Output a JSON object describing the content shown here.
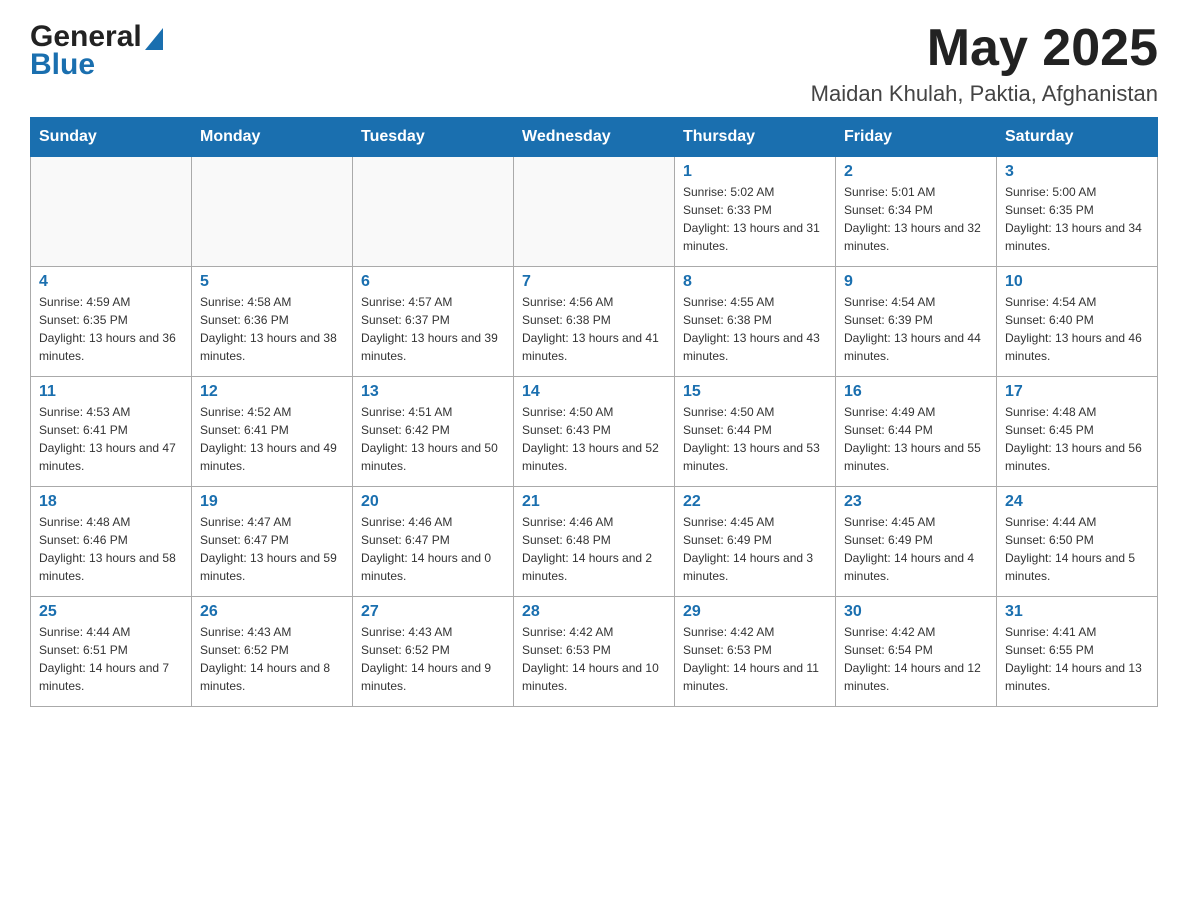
{
  "header": {
    "logo": {
      "general_text": "General",
      "blue_text": "Blue"
    },
    "month_title": "May 2025",
    "location": "Maidan Khulah, Paktia, Afghanistan"
  },
  "days_of_week": [
    "Sunday",
    "Monday",
    "Tuesday",
    "Wednesday",
    "Thursday",
    "Friday",
    "Saturday"
  ],
  "weeks": [
    [
      {
        "day": "",
        "info": ""
      },
      {
        "day": "",
        "info": ""
      },
      {
        "day": "",
        "info": ""
      },
      {
        "day": "",
        "info": ""
      },
      {
        "day": "1",
        "info": "Sunrise: 5:02 AM\nSunset: 6:33 PM\nDaylight: 13 hours and 31 minutes."
      },
      {
        "day": "2",
        "info": "Sunrise: 5:01 AM\nSunset: 6:34 PM\nDaylight: 13 hours and 32 minutes."
      },
      {
        "day": "3",
        "info": "Sunrise: 5:00 AM\nSunset: 6:35 PM\nDaylight: 13 hours and 34 minutes."
      }
    ],
    [
      {
        "day": "4",
        "info": "Sunrise: 4:59 AM\nSunset: 6:35 PM\nDaylight: 13 hours and 36 minutes."
      },
      {
        "day": "5",
        "info": "Sunrise: 4:58 AM\nSunset: 6:36 PM\nDaylight: 13 hours and 38 minutes."
      },
      {
        "day": "6",
        "info": "Sunrise: 4:57 AM\nSunset: 6:37 PM\nDaylight: 13 hours and 39 minutes."
      },
      {
        "day": "7",
        "info": "Sunrise: 4:56 AM\nSunset: 6:38 PM\nDaylight: 13 hours and 41 minutes."
      },
      {
        "day": "8",
        "info": "Sunrise: 4:55 AM\nSunset: 6:38 PM\nDaylight: 13 hours and 43 minutes."
      },
      {
        "day": "9",
        "info": "Sunrise: 4:54 AM\nSunset: 6:39 PM\nDaylight: 13 hours and 44 minutes."
      },
      {
        "day": "10",
        "info": "Sunrise: 4:54 AM\nSunset: 6:40 PM\nDaylight: 13 hours and 46 minutes."
      }
    ],
    [
      {
        "day": "11",
        "info": "Sunrise: 4:53 AM\nSunset: 6:41 PM\nDaylight: 13 hours and 47 minutes."
      },
      {
        "day": "12",
        "info": "Sunrise: 4:52 AM\nSunset: 6:41 PM\nDaylight: 13 hours and 49 minutes."
      },
      {
        "day": "13",
        "info": "Sunrise: 4:51 AM\nSunset: 6:42 PM\nDaylight: 13 hours and 50 minutes."
      },
      {
        "day": "14",
        "info": "Sunrise: 4:50 AM\nSunset: 6:43 PM\nDaylight: 13 hours and 52 minutes."
      },
      {
        "day": "15",
        "info": "Sunrise: 4:50 AM\nSunset: 6:44 PM\nDaylight: 13 hours and 53 minutes."
      },
      {
        "day": "16",
        "info": "Sunrise: 4:49 AM\nSunset: 6:44 PM\nDaylight: 13 hours and 55 minutes."
      },
      {
        "day": "17",
        "info": "Sunrise: 4:48 AM\nSunset: 6:45 PM\nDaylight: 13 hours and 56 minutes."
      }
    ],
    [
      {
        "day": "18",
        "info": "Sunrise: 4:48 AM\nSunset: 6:46 PM\nDaylight: 13 hours and 58 minutes."
      },
      {
        "day": "19",
        "info": "Sunrise: 4:47 AM\nSunset: 6:47 PM\nDaylight: 13 hours and 59 minutes."
      },
      {
        "day": "20",
        "info": "Sunrise: 4:46 AM\nSunset: 6:47 PM\nDaylight: 14 hours and 0 minutes."
      },
      {
        "day": "21",
        "info": "Sunrise: 4:46 AM\nSunset: 6:48 PM\nDaylight: 14 hours and 2 minutes."
      },
      {
        "day": "22",
        "info": "Sunrise: 4:45 AM\nSunset: 6:49 PM\nDaylight: 14 hours and 3 minutes."
      },
      {
        "day": "23",
        "info": "Sunrise: 4:45 AM\nSunset: 6:49 PM\nDaylight: 14 hours and 4 minutes."
      },
      {
        "day": "24",
        "info": "Sunrise: 4:44 AM\nSunset: 6:50 PM\nDaylight: 14 hours and 5 minutes."
      }
    ],
    [
      {
        "day": "25",
        "info": "Sunrise: 4:44 AM\nSunset: 6:51 PM\nDaylight: 14 hours and 7 minutes."
      },
      {
        "day": "26",
        "info": "Sunrise: 4:43 AM\nSunset: 6:52 PM\nDaylight: 14 hours and 8 minutes."
      },
      {
        "day": "27",
        "info": "Sunrise: 4:43 AM\nSunset: 6:52 PM\nDaylight: 14 hours and 9 minutes."
      },
      {
        "day": "28",
        "info": "Sunrise: 4:42 AM\nSunset: 6:53 PM\nDaylight: 14 hours and 10 minutes."
      },
      {
        "day": "29",
        "info": "Sunrise: 4:42 AM\nSunset: 6:53 PM\nDaylight: 14 hours and 11 minutes."
      },
      {
        "day": "30",
        "info": "Sunrise: 4:42 AM\nSunset: 6:54 PM\nDaylight: 14 hours and 12 minutes."
      },
      {
        "day": "31",
        "info": "Sunrise: 4:41 AM\nSunset: 6:55 PM\nDaylight: 14 hours and 13 minutes."
      }
    ]
  ],
  "colors": {
    "header_bg": "#1a6faf",
    "header_text": "#ffffff",
    "day_number": "#1a6faf",
    "border": "#aaa"
  }
}
